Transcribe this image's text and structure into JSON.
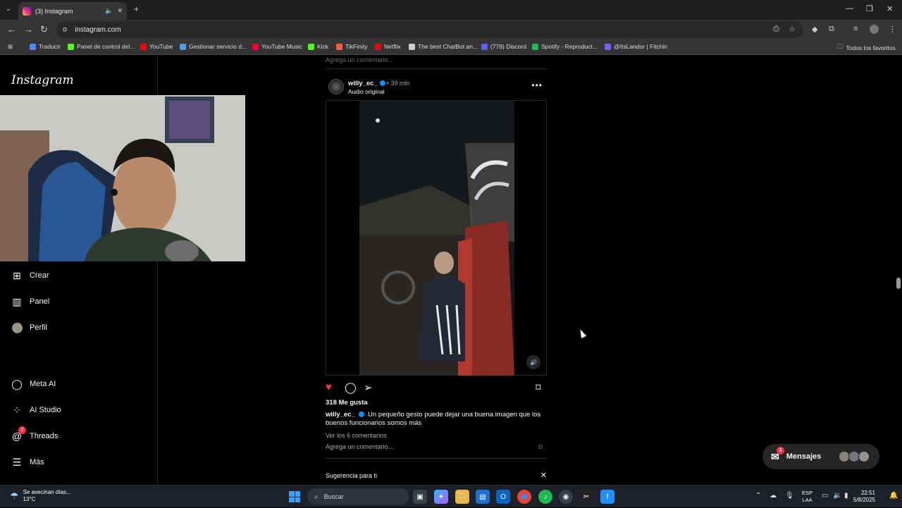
{
  "browser": {
    "tab_title": "(3) Instagram",
    "url": "instagram.com",
    "bookmarks": [
      {
        "label": "Traducir",
        "color": "#4a8af4"
      },
      {
        "label": "Panel de control del...",
        "color": "#53fc18"
      },
      {
        "label": "YouTube",
        "color": "#ff0000"
      },
      {
        "label": "Gestionar servicio d...",
        "color": "#4aa0e6"
      },
      {
        "label": "YouTube Music",
        "color": "#ff0033"
      },
      {
        "label": "Kick",
        "color": "#53fc18"
      },
      {
        "label": "TikFinity",
        "color": "#ff5a3c"
      },
      {
        "label": "Netflix",
        "color": "#e50914"
      },
      {
        "label": "The best ChatBot an...",
        "color": "#cccccc"
      },
      {
        "label": "(778) Discord",
        "color": "#5865f2"
      },
      {
        "label": "Spotify - Reproduct...",
        "color": "#1db954"
      },
      {
        "label": "@ItsLandor | Fitchin",
        "color": "#7b5cff"
      }
    ],
    "all_favorites": "Todos los favoritos"
  },
  "instagram": {
    "logo": "Instagram",
    "nav": [
      {
        "label": "Crear",
        "icon": "plus-square-icon"
      },
      {
        "label": "Panel",
        "icon": "chart-icon"
      },
      {
        "label": "Perfil",
        "icon": "avatar-icon"
      },
      {
        "label": "Meta AI",
        "icon": "meta-ai-icon"
      },
      {
        "label": "AI Studio",
        "icon": "ai-studio-icon"
      },
      {
        "label": "Threads",
        "icon": "threads-icon",
        "badge": "2"
      },
      {
        "label": "Más",
        "icon": "menu-icon"
      }
    ],
    "prev_comment_placeholder": "Agrega un comentario...",
    "post": {
      "username": "willy_ec_",
      "time": "• 39 min",
      "audio": "Audio original",
      "likes": "318 Me gusta",
      "caption": "Un pequeño gesto puede dejar una buena imagen que los buenos funcionarios somos más",
      "view_comments": "Ver los 6 comentarios",
      "add_comment": "Agrega un comentario..."
    },
    "suggestion": "Sugerencia para ti",
    "messages": {
      "label": "Mensajes",
      "badge": "3"
    }
  },
  "taskbar": {
    "weather_line1": "Se avecinan días...",
    "weather_line2": "13°C",
    "search_placeholder": "Buscar",
    "lang1": "ESP",
    "lang2": "LAA",
    "time": "22:51",
    "date": "5/8/2025"
  }
}
